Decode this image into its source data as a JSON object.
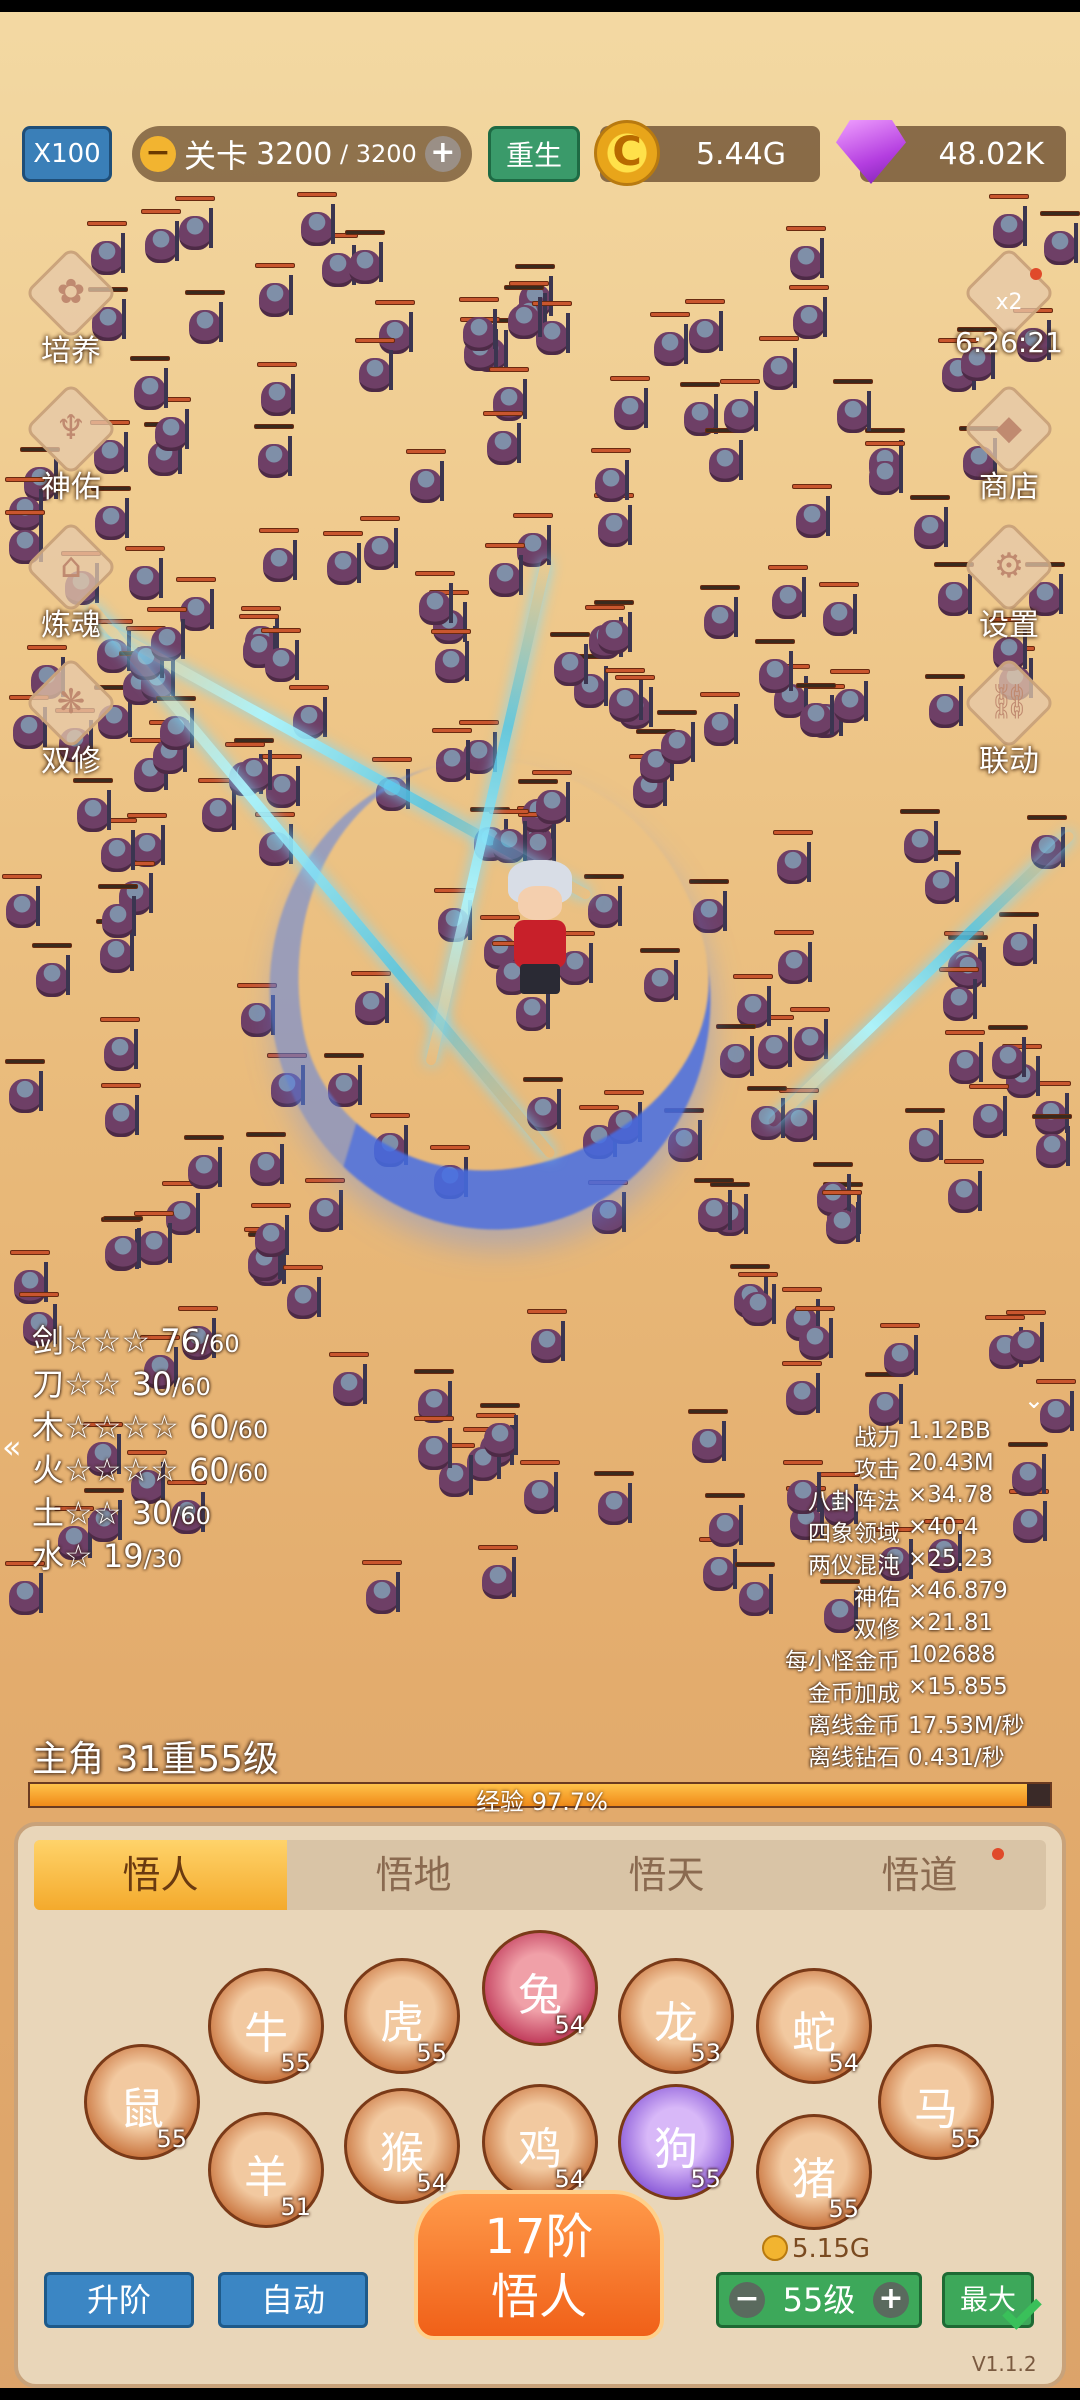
{
  "topbar": {
    "multiplier": "X100",
    "stage_label": "关卡",
    "stage_current": "3200",
    "stage_max": "3200",
    "rebirth": "重生",
    "gold": "5.44G",
    "gems": "48.02K",
    "gold_icon_glyph": "C"
  },
  "left_menu": [
    "培养",
    "神佑",
    "炼魂",
    "双修"
  ],
  "right_menu": {
    "bonus_multiplier": "x2",
    "bonus_timer": "6:26:21",
    "shop": "商店",
    "settings": "设置",
    "link": "联动"
  },
  "elements": [
    {
      "name": "剑",
      "stars": "☆☆☆",
      "cur": "76",
      "max": "/60"
    },
    {
      "name": "刀",
      "stars": "☆☆",
      "cur": "30",
      "max": "/60"
    },
    {
      "name": "木",
      "stars": "☆☆☆☆",
      "cur": "60",
      "max": "/60"
    },
    {
      "name": "火",
      "stars": "☆☆☆☆",
      "cur": "60",
      "max": "/60"
    },
    {
      "name": "土",
      "stars": "☆☆",
      "cur": "30",
      "max": "/60"
    },
    {
      "name": "水",
      "stars": "☆",
      "cur": "19",
      "max": "/30"
    }
  ],
  "stats": [
    {
      "k": "战力",
      "v": "1.12BB"
    },
    {
      "k": "攻击",
      "v": "20.43M"
    },
    {
      "k": "八卦阵法",
      "v": "×34.78"
    },
    {
      "k": "四象领域",
      "v": "×40.4"
    },
    {
      "k": "两仪混沌",
      "v": "×25.23"
    },
    {
      "k": "神佑",
      "v": "×46.879"
    },
    {
      "k": "双修",
      "v": "×21.81"
    },
    {
      "k": "每小怪金币",
      "v": "102688"
    },
    {
      "k": "金币加成",
      "v": "×15.855"
    },
    {
      "k": "离线金币",
      "v": "17.53M/秒"
    },
    {
      "k": "离线钻石",
      "v": "0.431/秒"
    }
  ],
  "hero": {
    "level_text": "主角 31重55级",
    "exp_text": "经验 97.7%",
    "exp_fraction": 0.977
  },
  "tabs": [
    "悟人",
    "悟地",
    "悟天",
    "悟道"
  ],
  "zodiac": [
    {
      "name": "rat-icon",
      "glyph": "鼠",
      "level": "55",
      "style": ""
    },
    {
      "name": "ox-icon",
      "glyph": "牛",
      "level": "55",
      "style": ""
    },
    {
      "name": "tiger-icon",
      "glyph": "虎",
      "level": "55",
      "style": ""
    },
    {
      "name": "rabbit-icon",
      "glyph": "兔",
      "level": "54",
      "style": "red"
    },
    {
      "name": "dragon-icon",
      "glyph": "龙",
      "level": "53",
      "style": ""
    },
    {
      "name": "snake-icon",
      "glyph": "蛇",
      "level": "54",
      "style": ""
    },
    {
      "name": "horse-icon",
      "glyph": "马",
      "level": "55",
      "style": ""
    },
    {
      "name": "goat-icon",
      "glyph": "羊",
      "level": "51",
      "style": ""
    },
    {
      "name": "monkey-icon",
      "glyph": "猴",
      "level": "54",
      "style": ""
    },
    {
      "name": "rooster-icon",
      "glyph": "鸡",
      "level": "54",
      "style": ""
    },
    {
      "name": "dog-icon",
      "glyph": "狗",
      "level": "55",
      "style": "purple"
    },
    {
      "name": "pig-icon",
      "glyph": "猪",
      "level": "55",
      "style": ""
    }
  ],
  "bottom": {
    "upgrade": "升阶",
    "auto": "自动",
    "promote_line1": "17阶",
    "promote_line2": "悟人",
    "cost": "5.15G",
    "level_value": "55级",
    "max": "最大",
    "version": "V1.1.2"
  }
}
